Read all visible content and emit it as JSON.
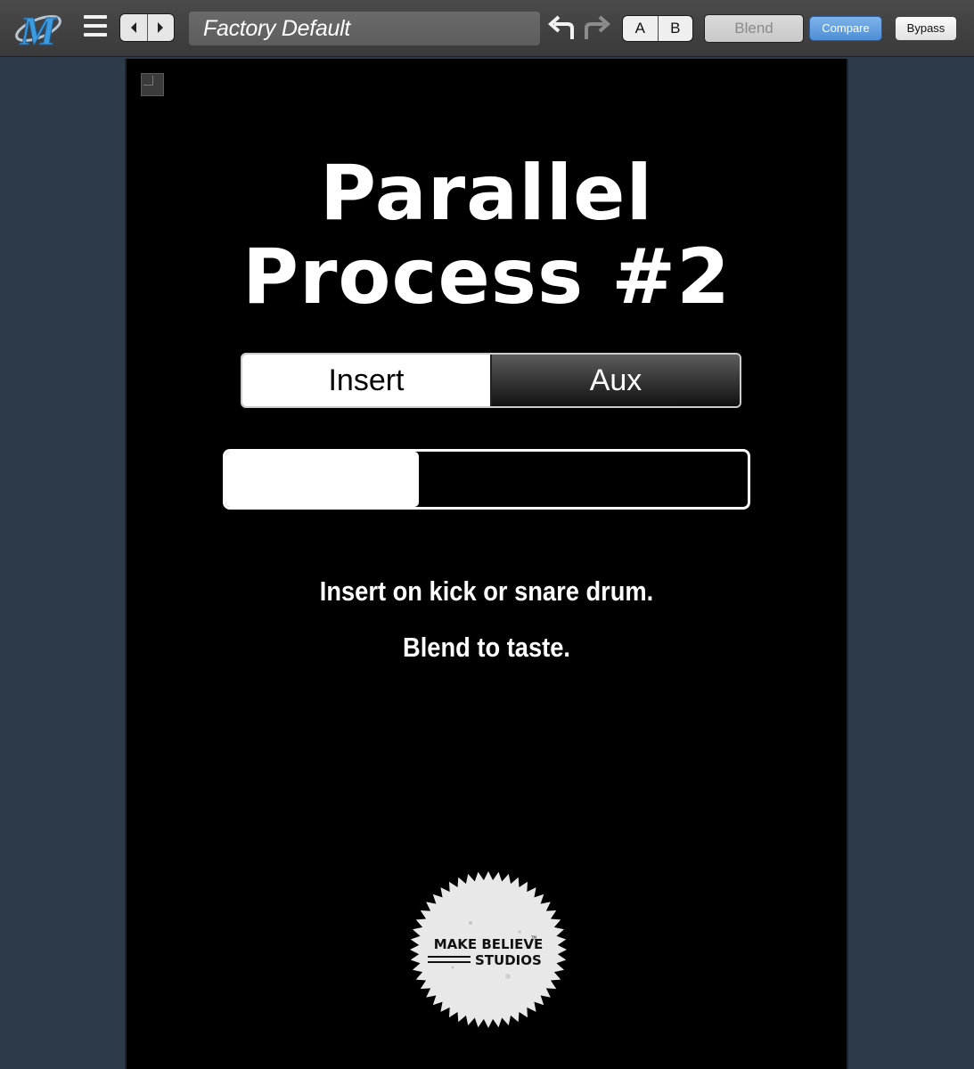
{
  "toolbar": {
    "logo_icon": "m-logo",
    "preset_name": "Factory Default",
    "ab_a": "A",
    "ab_b": "B",
    "blend_label": "Blend",
    "compare_label": "Compare",
    "bypass_label": "Bypass",
    "colors": {
      "compare_active": "#5a98dc",
      "background": "#2c3a49"
    }
  },
  "plugin": {
    "title_line1": "Parallel",
    "title_line2": "Process #2",
    "mode_options": [
      "Insert",
      "Aux"
    ],
    "mode_selected": "Insert",
    "blend_amount": 0.37,
    "desc_line1": "Insert on kick or snare drum.",
    "desc_line2": "Blend to taste.",
    "seal": {
      "line1": "MAKE BELIEVE",
      "line2": "STUDIOS",
      "tm": "TM"
    }
  }
}
